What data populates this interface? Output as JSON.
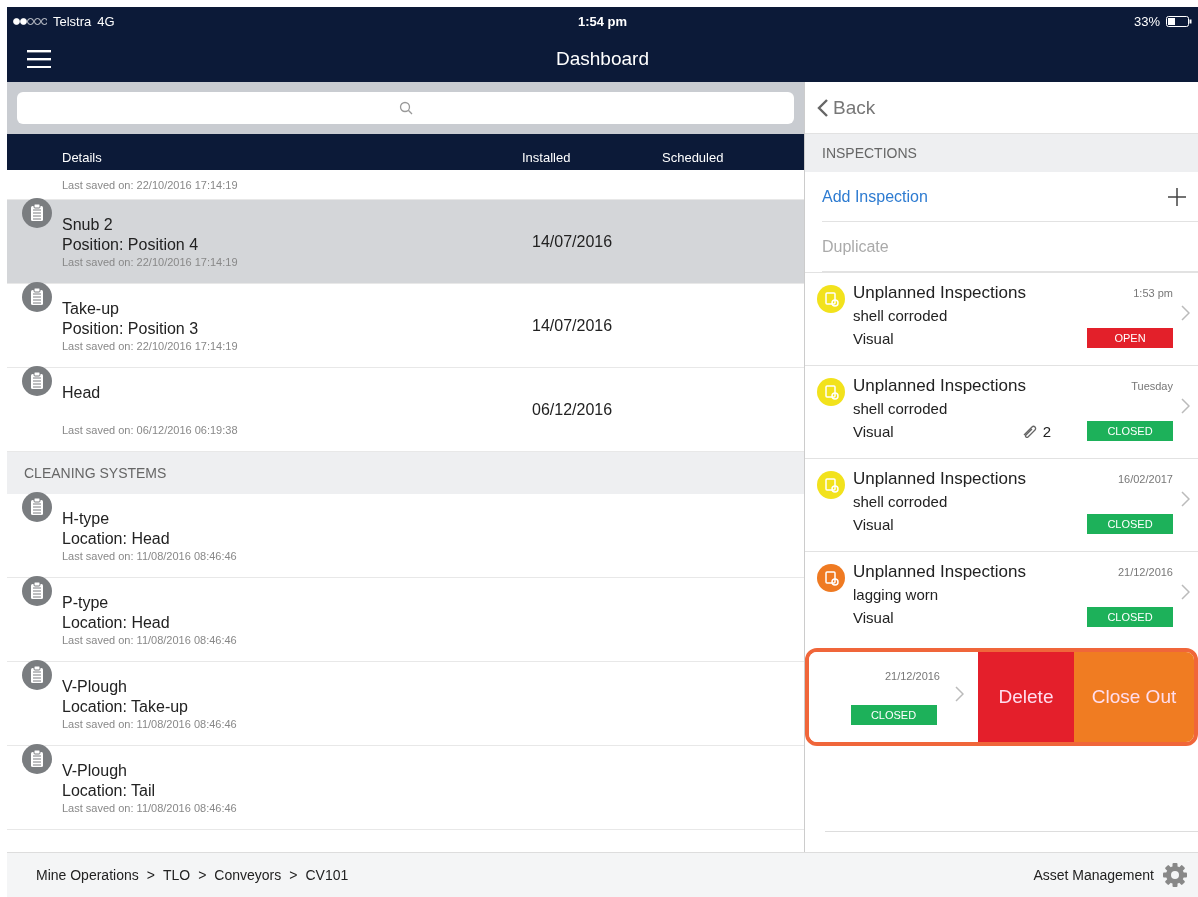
{
  "status_bar": {
    "carrier": "Telstra",
    "network": "4G",
    "time": "1:54 pm",
    "battery": "33%"
  },
  "nav": {
    "title": "Dashboard"
  },
  "list": {
    "columns": [
      "Details",
      "Installed",
      "Scheduled"
    ],
    "items": [
      {
        "kind": "partial_row",
        "selected": false,
        "saved": "Last saved on: 22/10/2016 17:14:19"
      },
      {
        "kind": "row",
        "selected": true,
        "name": "Snub 2",
        "detail": "Position: Position 4",
        "saved": "Last saved on: 22/10/2016 17:14:19",
        "installed": "14/07/2016"
      },
      {
        "kind": "row",
        "selected": false,
        "name": "Take-up",
        "detail": "Position: Position 3",
        "saved": "Last saved on: 22/10/2016 17:14:19",
        "installed": "14/07/2016"
      },
      {
        "kind": "row",
        "selected": false,
        "name": "Head",
        "saved": "Last saved on: 06/12/2016 06:19:38",
        "installed": "06/12/2016"
      },
      {
        "kind": "header",
        "label": "CLEANING SYSTEMS"
      },
      {
        "kind": "row",
        "selected": false,
        "name": "H-type",
        "detail": "Location: Head",
        "saved": "Last saved on: 11/08/2016 08:46:46"
      },
      {
        "kind": "row",
        "selected": false,
        "name": "P-type",
        "detail": "Location: Head",
        "saved": "Last saved on: 11/08/2016 08:46:46"
      },
      {
        "kind": "row",
        "selected": false,
        "name": "V-Plough",
        "detail": "Location: Take-up",
        "saved": "Last saved on: 11/08/2016 08:46:46"
      },
      {
        "kind": "row",
        "selected": false,
        "name": "V-Plough",
        "detail": "Location: Tail",
        "saved": "Last saved on: 11/08/2016 08:46:46"
      }
    ]
  },
  "panel": {
    "back": "Back",
    "section": "INSPECTIONS",
    "actions": [
      {
        "label": "Add Inspection",
        "kind": "add",
        "disabled": false
      },
      {
        "label": "Duplicate",
        "kind": "plain",
        "disabled": true
      }
    ],
    "inspections": [
      {
        "title": "Unplanned Inspections",
        "when": "1:53 pm",
        "finding": "shell corroded",
        "method": "Visual",
        "status": "OPEN",
        "open": true,
        "color": "#f2e21c"
      },
      {
        "title": "Unplanned Inspections",
        "when": "Tuesday",
        "finding": "shell corroded",
        "method": "Visual",
        "attachments": "2",
        "status": "CLOSED",
        "open": false,
        "color": "#f2e21c"
      },
      {
        "title": "Unplanned Inspections",
        "when": "16/02/2017",
        "finding": "shell corroded",
        "method": "Visual",
        "status": "CLOSED",
        "open": false,
        "color": "#f2e21c"
      },
      {
        "title": "Unplanned Inspections",
        "when": "21/12/2016",
        "finding": "lagging worn",
        "method": "Visual",
        "status": "CLOSED",
        "open": false,
        "color": "#ef7a22"
      }
    ],
    "swiped": {
      "when": "21/12/2016",
      "status": "CLOSED",
      "open": false,
      "actions": [
        {
          "label": "Delete",
          "kind": "delete"
        },
        {
          "label": "Close Out",
          "kind": "close"
        }
      ]
    }
  },
  "footer": {
    "breadcrumb": [
      "Mine Operations",
      "TLO",
      "Conveyors",
      "CV101"
    ],
    "separator": ">",
    "app": "Asset Management"
  }
}
